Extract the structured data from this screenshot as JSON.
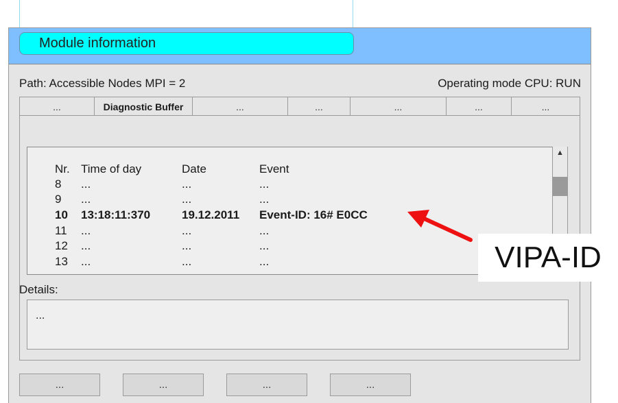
{
  "window": {
    "title": "Module information",
    "path": "Path: Accessible Nodes MPI = 2",
    "operating_mode": "Operating mode CPU: RUN"
  },
  "tabs": [
    {
      "label": "..."
    },
    {
      "label": "Diagnostic Buffer",
      "active": true
    },
    {
      "label": "..."
    },
    {
      "label": "..."
    },
    {
      "label": "..."
    },
    {
      "label": "..."
    },
    {
      "label": "..."
    }
  ],
  "buffer": {
    "headers": {
      "nr": "Nr.",
      "time": "Time of day",
      "date": "Date",
      "event": "Event"
    },
    "rows": [
      {
        "nr": "8",
        "time": "...",
        "date": "...",
        "event": "..."
      },
      {
        "nr": "9",
        "time": "...",
        "date": "...",
        "event": "..."
      },
      {
        "nr": "10",
        "time": "13:18:11:370",
        "date": "19.12.2011",
        "event": "Event-ID: 16# E0CC",
        "highlight": true
      },
      {
        "nr": "11",
        "time": "...",
        "date": "...",
        "event": "..."
      },
      {
        "nr": "12",
        "time": "...",
        "date": "...",
        "event": "..."
      },
      {
        "nr": "13",
        "time": "...",
        "date": "...",
        "event": "..."
      }
    ]
  },
  "details": {
    "label": "Details:",
    "value": "..."
  },
  "buttons": [
    {
      "label": "..."
    },
    {
      "label": "..."
    },
    {
      "label": "..."
    },
    {
      "label": "..."
    }
  ],
  "annotation": {
    "label": "VIPA-ID",
    "arrow_color": "#ee1111"
  },
  "icons": {
    "scroll_up": "triangle-up-icon",
    "annotation_arrow": "arrow-icon"
  },
  "colors": {
    "titlebar": "#80bfff",
    "title_pill": "#00ffff",
    "window_bg": "#e5e5e5"
  }
}
